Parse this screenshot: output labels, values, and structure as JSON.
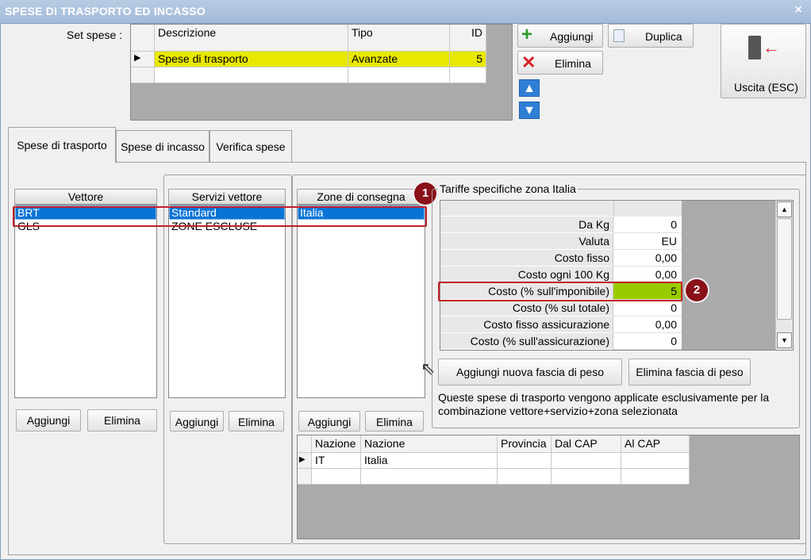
{
  "window": {
    "title": "SPESE DI TRASPORTO ED INCASSO",
    "close": "×"
  },
  "set_spese": {
    "label": "Set spese :",
    "columns": [
      "Descrizione",
      "Tipo",
      "ID"
    ],
    "rows": [
      {
        "descrizione": "Spese di trasporto",
        "tipo": "Avanzate",
        "id": "5"
      }
    ]
  },
  "toolbar": {
    "aggiungi": "Aggiungi",
    "duplica": "Duplica",
    "elimina": "Elimina",
    "uscita": "Uscita (ESC)"
  },
  "tabs": [
    "Spese di trasporto",
    "Spese di incasso",
    "Verifica spese"
  ],
  "vettore": {
    "header": "Vettore",
    "items": [
      "BRT",
      "GLS"
    ],
    "add": "Aggiungi",
    "del": "Elimina"
  },
  "servizi": {
    "header": "Servizi vettore",
    "items": [
      "Standard",
      "ZONE ESCLUSE"
    ],
    "add": "Aggiungi",
    "del": "Elimina"
  },
  "zone": {
    "header": "Zone di consegna",
    "items": [
      "Italia"
    ],
    "add": "Aggiungi",
    "del": "Elimina"
  },
  "tariffe": {
    "legend": "Tariffe specifiche zona Italia",
    "rows": [
      {
        "label": "Da Kg",
        "value": "0"
      },
      {
        "label": "Valuta",
        "value": "EU"
      },
      {
        "label": "Costo fisso",
        "value": "0,00"
      },
      {
        "label": "Costo ogni 100 Kg",
        "value": "0,00"
      },
      {
        "label": "Costo (% sull'imponibile)",
        "value": "5"
      },
      {
        "label": "Costo (% sul totale)",
        "value": "0"
      },
      {
        "label": "Costo fisso assicurazione",
        "value": "0,00"
      },
      {
        "label": "Costo (% sull'assicurazione)",
        "value": "0"
      }
    ],
    "add_btn": "Aggiungi nuova fascia di peso",
    "del_btn": "Elimina fascia di peso",
    "note": "Queste spese di trasporto vengono applicate esclusivamente per la combinazione vettore+servizio+zona selezionata"
  },
  "nazioni": {
    "columns": [
      "Nazione",
      "Nazione",
      "Provincia",
      "Dal CAP",
      "Al CAP"
    ],
    "rows": [
      {
        "code": "IT",
        "name": "Italia",
        "prov": "",
        "dal": "",
        "al": ""
      }
    ]
  },
  "callouts": [
    "1",
    "2"
  ],
  "colors": {
    "highlight": "#e8e800",
    "green": "#99cc00",
    "selection": "#0a74d5",
    "callout": "#c0202a"
  }
}
